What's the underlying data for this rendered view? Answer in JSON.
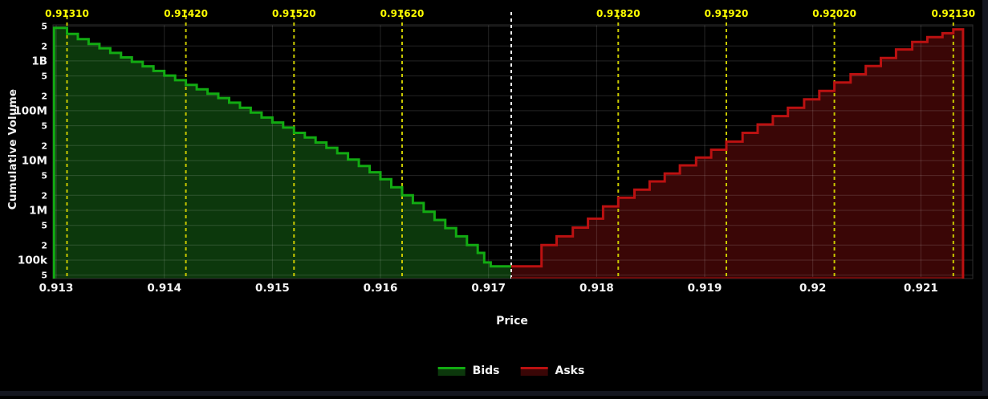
{
  "window": {
    "bg": "#000000",
    "edge_color": "#14161f"
  },
  "legend": {
    "items": [
      {
        "label": "Bids"
      },
      {
        "label": "Asks"
      }
    ]
  },
  "chart_data": {
    "type": "area",
    "subtype": "order-book-depth-step-chart",
    "title": "",
    "xlabel": "Price",
    "ylabel": "Cumulative Volume",
    "y_scale": "log",
    "grid": true,
    "xlim": [
      0.91297,
      0.92148
    ],
    "ylim": [
      42600,
      5300000000
    ],
    "colors": {
      "background": "#000000",
      "grid": "#ffffff",
      "plot_border": "#2e2e2e",
      "tick_text": "#f5f5f5",
      "marker_text": "#ffff00",
      "marker_line": "#c9c900",
      "mid_line": "#ffffff"
    },
    "x_ticks": [
      {
        "v": 0.913,
        "label": "0.913"
      },
      {
        "v": 0.914,
        "label": "0.914"
      },
      {
        "v": 0.915,
        "label": "0.915"
      },
      {
        "v": 0.916,
        "label": "0.916"
      },
      {
        "v": 0.917,
        "label": "0.917"
      },
      {
        "v": 0.918,
        "label": "0.918"
      },
      {
        "v": 0.919,
        "label": "0.919"
      },
      {
        "v": 0.92,
        "label": "0.92"
      },
      {
        "v": 0.921,
        "label": "0.921"
      }
    ],
    "y_ticks": [
      {
        "v": 50000,
        "label": "5",
        "major": false
      },
      {
        "v": 100000,
        "label": "100k",
        "major": true
      },
      {
        "v": 200000,
        "label": "2",
        "major": false
      },
      {
        "v": 500000,
        "label": "5",
        "major": false
      },
      {
        "v": 1000000,
        "label": "1M",
        "major": true
      },
      {
        "v": 2000000,
        "label": "2",
        "major": false
      },
      {
        "v": 5000000,
        "label": "5",
        "major": false
      },
      {
        "v": 10000000,
        "label": "10M",
        "major": true
      },
      {
        "v": 20000000,
        "label": "2",
        "major": false
      },
      {
        "v": 50000000,
        "label": "5",
        "major": false
      },
      {
        "v": 100000000,
        "label": "100M",
        "major": true
      },
      {
        "v": 200000000,
        "label": "2",
        "major": false
      },
      {
        "v": 500000000,
        "label": "5",
        "major": false
      },
      {
        "v": 1000000000,
        "label": "1B",
        "major": true
      },
      {
        "v": 2000000000,
        "label": "2",
        "major": false
      },
      {
        "v": 5000000000,
        "label": "5",
        "major": false
      }
    ],
    "price_markers": [
      {
        "price": 0.9131,
        "label": "0.91310"
      },
      {
        "price": 0.9142,
        "label": "0.91420"
      },
      {
        "price": 0.9152,
        "label": "0.91520"
      },
      {
        "price": 0.9162,
        "label": "0.91620"
      },
      {
        "price": 0.9182,
        "label": "0.91820"
      },
      {
        "price": 0.9192,
        "label": "0.91920"
      },
      {
        "price": 0.9202,
        "label": "0.92020"
      },
      {
        "price": 0.9213,
        "label": "0.92130"
      }
    ],
    "mid_price": 0.91721,
    "series": [
      {
        "name": "Bids",
        "line_color": "#12ab12",
        "fill_color": "#0c380c",
        "edge": "start",
        "end_price": 0.91721,
        "steps": [
          [
            0.91298,
            4600000000
          ],
          [
            0.9131,
            3500000000
          ],
          [
            0.9132,
            2750000000
          ],
          [
            0.9133,
            2200000000
          ],
          [
            0.9134,
            1800000000
          ],
          [
            0.9135,
            1450000000
          ],
          [
            0.9136,
            1180000000
          ],
          [
            0.9137,
            960000000
          ],
          [
            0.9138,
            780000000
          ],
          [
            0.9139,
            630000000
          ],
          [
            0.914,
            510000000
          ],
          [
            0.9141,
            410000000
          ],
          [
            0.9142,
            330000000
          ],
          [
            0.9143,
            270000000
          ],
          [
            0.9144,
            220000000
          ],
          [
            0.9145,
            180000000
          ],
          [
            0.9146,
            145000000
          ],
          [
            0.9147,
            115000000
          ],
          [
            0.9148,
            92000000
          ],
          [
            0.9149,
            73000000
          ],
          [
            0.915,
            58000000
          ],
          [
            0.9151,
            46000000
          ],
          [
            0.9152,
            36000000
          ],
          [
            0.9153,
            29000000
          ],
          [
            0.9154,
            23000000
          ],
          [
            0.9155,
            18000000
          ],
          [
            0.9156,
            14000000
          ],
          [
            0.9157,
            10500000
          ],
          [
            0.9158,
            7800000
          ],
          [
            0.9159,
            5800000
          ],
          [
            0.916,
            4200000
          ],
          [
            0.9161,
            2900000
          ],
          [
            0.9162,
            2000000
          ],
          [
            0.9163,
            1400000
          ],
          [
            0.9164,
            940000
          ],
          [
            0.9165,
            640000
          ],
          [
            0.9166,
            440000
          ],
          [
            0.9167,
            300000
          ],
          [
            0.9168,
            200000
          ],
          [
            0.9169,
            140000
          ],
          [
            0.91696,
            90000
          ],
          [
            0.91702,
            75000
          ]
        ]
      },
      {
        "name": "Asks",
        "line_color": "#bb1111",
        "fill_color": "#3a0606",
        "edge": "end",
        "end_price": 0.92139,
        "bottom_edge_color": "#6e0a0a",
        "steps": [
          [
            0.91721,
            75000
          ],
          [
            0.91749,
            200000
          ],
          [
            0.91763,
            300000
          ],
          [
            0.91778,
            450000
          ],
          [
            0.91792,
            680000
          ],
          [
            0.91806,
            1200000
          ],
          [
            0.9182,
            1800000
          ],
          [
            0.91835,
            2600000
          ],
          [
            0.91849,
            3800000
          ],
          [
            0.91863,
            5500000
          ],
          [
            0.91877,
            8000000
          ],
          [
            0.91892,
            11500000
          ],
          [
            0.91906,
            16500000
          ],
          [
            0.9192,
            24000000
          ],
          [
            0.91935,
            36000000
          ],
          [
            0.91949,
            53000000
          ],
          [
            0.91963,
            78000000
          ],
          [
            0.91977,
            115000000
          ],
          [
            0.91992,
            170000000
          ],
          [
            0.92006,
            250000000
          ],
          [
            0.9202,
            370000000
          ],
          [
            0.92035,
            540000000
          ],
          [
            0.92049,
            790000000
          ],
          [
            0.92063,
            1150000000
          ],
          [
            0.92077,
            1700000000
          ],
          [
            0.92092,
            2400000000
          ],
          [
            0.92106,
            3000000000
          ],
          [
            0.9212,
            3600000000
          ],
          [
            0.9213,
            4300000000
          ]
        ]
      }
    ]
  }
}
